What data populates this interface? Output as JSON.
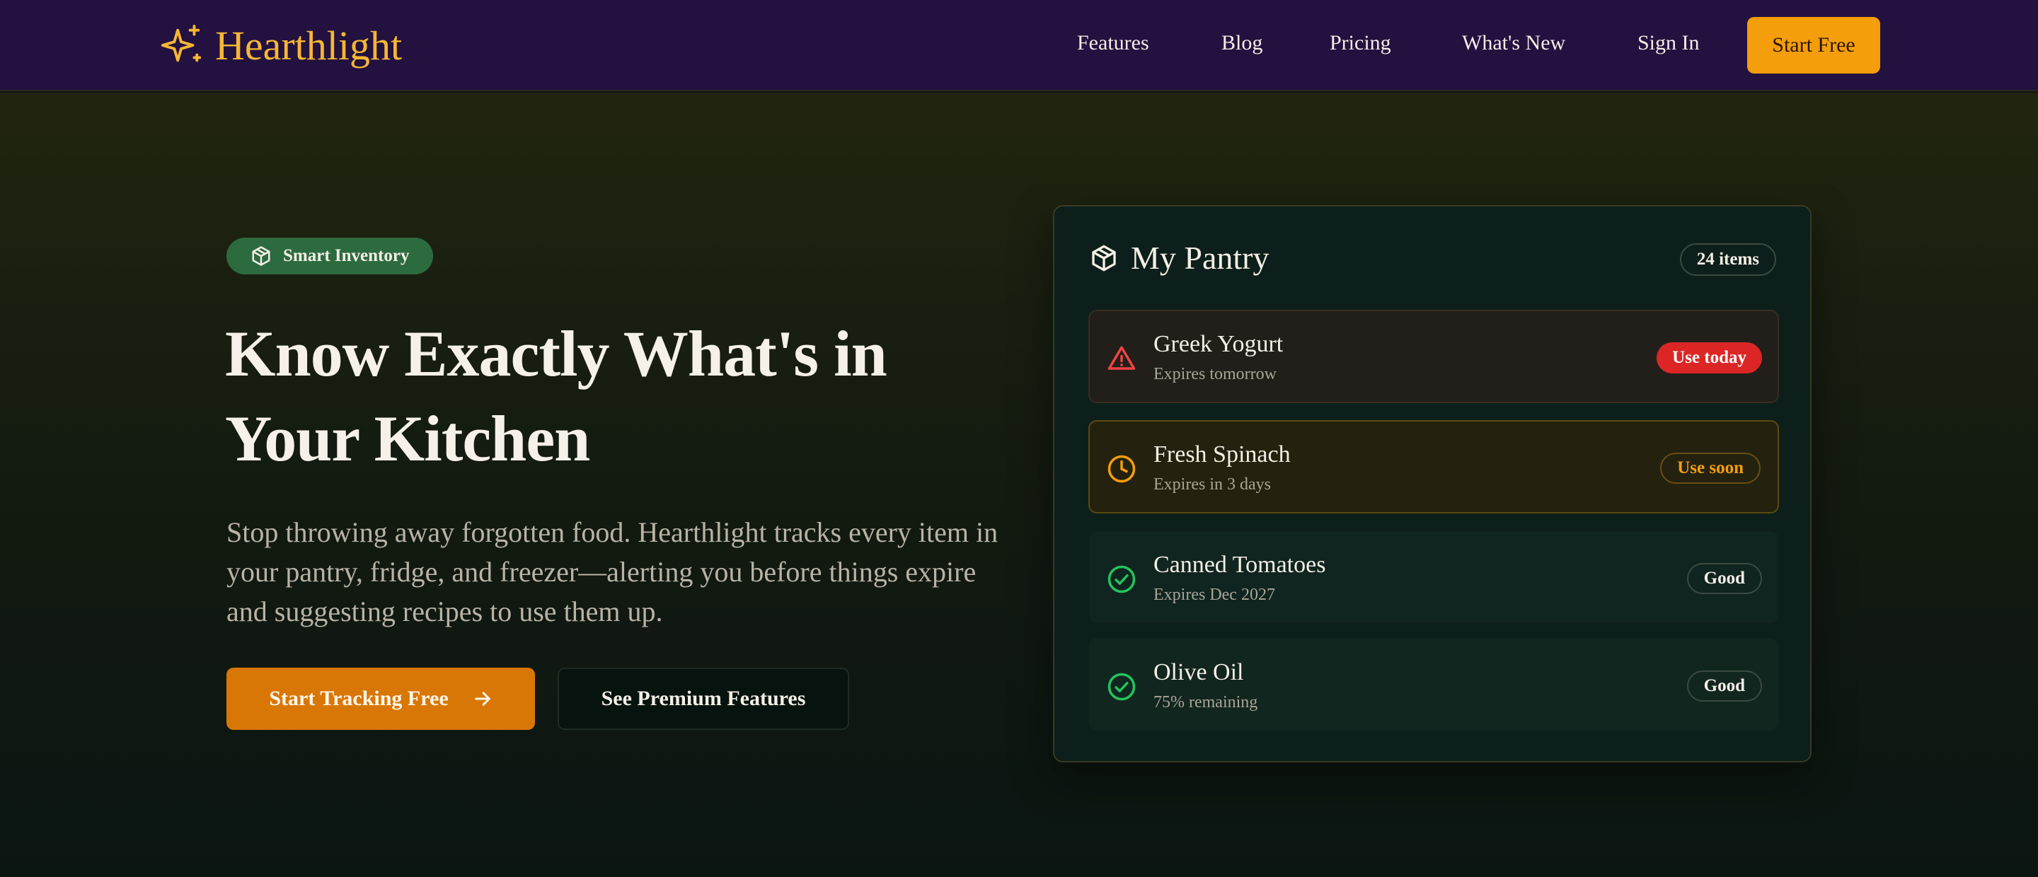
{
  "brand": {
    "name": "Hearthlight",
    "color": "#f7b733"
  },
  "nav": {
    "links": [
      "Features",
      "Blog",
      "Pricing",
      "What's New",
      "Sign In"
    ],
    "cta": "Start Free"
  },
  "hero": {
    "badge": "Smart Inventory",
    "headline_line1": "Know Exactly What's in",
    "headline_line2": "Your Kitchen",
    "subtitle": "Stop throwing away forgotten food. Hearthlight tracks every item in your pantry, fridge, and freezer—alerting you before things expire and suggesting recipes to use them up.",
    "primary_button": "Start Tracking Free",
    "secondary_button": "See Premium Features"
  },
  "pantry": {
    "title": "My Pantry",
    "count": "24 items",
    "items": [
      {
        "name": "Greek Yogurt",
        "meta": "Expires tomorrow",
        "status": "Use today",
        "icon": "alert-triangle-icon"
      },
      {
        "name": "Fresh Spinach",
        "meta": "Expires in 3 days",
        "status": "Use soon",
        "icon": "clock-icon"
      },
      {
        "name": "Canned Tomatoes",
        "meta": "Expires Dec 2027",
        "status": "Good",
        "icon": "check-circle-icon"
      },
      {
        "name": "Olive Oil",
        "meta": "75% remaining",
        "status": "Good",
        "icon": "check-circle-icon"
      }
    ]
  },
  "colors": {
    "nav_bg": "#231140",
    "accent_orange": "#d97706",
    "cta_amber": "#f59e0b",
    "badge_green": "#2c6b3f",
    "danger_red": "#dc2626",
    "good_green": "#22c55e"
  }
}
